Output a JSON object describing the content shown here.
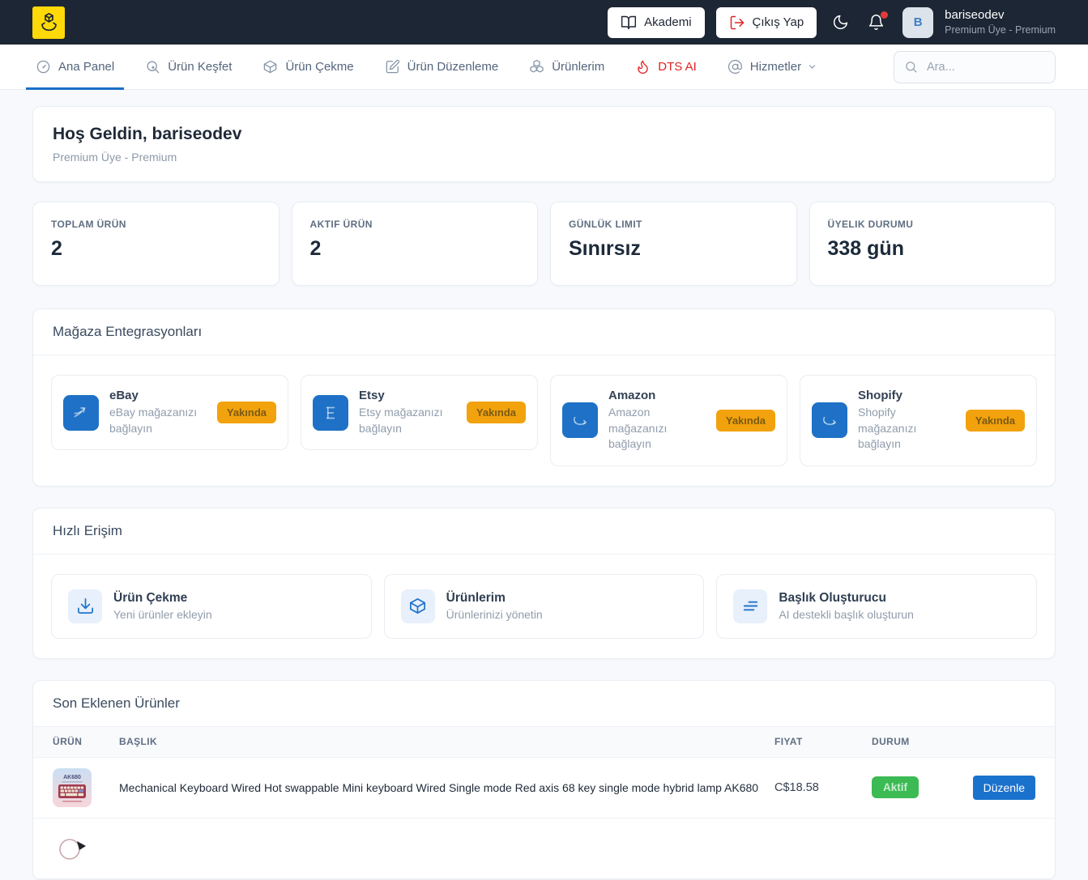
{
  "colors": {
    "header_bg": "#1d2634",
    "brand_yellow": "#ffd908",
    "accent_blue": "#1b72c8",
    "accent_red": "#e02424",
    "badge_orange": "#f2a20c",
    "status_green": "#3cba54",
    "page_bg": "#f7f9fc"
  },
  "header": {
    "academy": "Akademi",
    "logout": "Çıkış Yap",
    "user_initial": "B",
    "user_name": "bariseodev",
    "user_plan": "Premium Üye - Premium"
  },
  "nav": {
    "items": [
      {
        "label": "Ana Panel"
      },
      {
        "label": "Ürün Keşfet"
      },
      {
        "label": "Ürün Çekme"
      },
      {
        "label": "Ürün Düzenleme"
      },
      {
        "label": "Ürünlerim"
      },
      {
        "label": "DTS AI"
      },
      {
        "label": "Hizmetler"
      }
    ],
    "search_placeholder": "Ara..."
  },
  "welcome": {
    "title": "Hoş Geldin, bariseodev",
    "subtitle": "Premium Üye - Premium"
  },
  "stats": [
    {
      "label": "TOPLAM ÜRÜN",
      "value": "2"
    },
    {
      "label": "AKTIF ÜRÜN",
      "value": "2"
    },
    {
      "label": "GÜNLÜK LIMIT",
      "value": "Sınırsız"
    },
    {
      "label": "ÜYELIK DURUMU",
      "value": "338 gün"
    }
  ],
  "integrations": {
    "title": "Mağaza Entegrasyonları",
    "badge": "Yakında",
    "items": [
      {
        "name": "eBay",
        "description": "eBay mağazanızı bağlayın"
      },
      {
        "name": "Etsy",
        "description": "Etsy mağazanızı bağlayın"
      },
      {
        "name": "Amazon",
        "description": "Amazon mağazanızı bağlayın"
      },
      {
        "name": "Shopify",
        "description": "Shopify mağazanızı bağlayın"
      }
    ]
  },
  "quick_access": {
    "title": "Hızlı Erişim",
    "items": [
      {
        "title": "Ürün Çekme",
        "description": "Yeni ürünler ekleyin"
      },
      {
        "title": "Ürünlerim",
        "description": "Ürünlerinizi yönetin"
      },
      {
        "title": "Başlık Oluşturucu",
        "description": "AI destekli başlık oluşturun"
      }
    ]
  },
  "products": {
    "title": "Son Eklenen Ürünler",
    "columns": {
      "product": "ÜRÜN",
      "title": "BAŞLIK",
      "price": "FIYAT",
      "status": "DURUM"
    },
    "rows": [
      {
        "thumbnail_label": "AK680",
        "title": "Mechanical Keyboard Wired Hot swappable Mini keyboard Wired Single mode Red axis 68 key single mode hybrid lamp AK680",
        "price": "C$18.58",
        "status": "Aktif",
        "action": "Düzenle"
      }
    ]
  }
}
